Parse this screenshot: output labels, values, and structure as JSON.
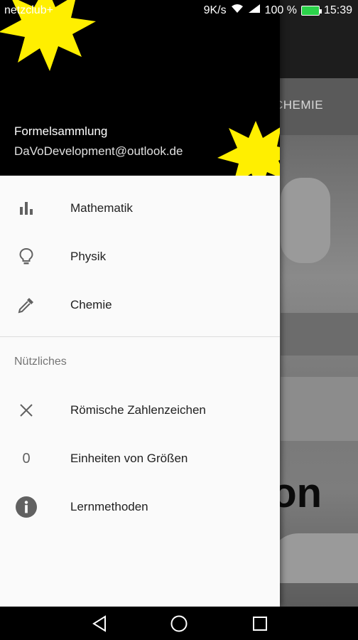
{
  "status_bar": {
    "carrier": "netzclub+",
    "speed": "9K/s",
    "battery_percent": "100 %",
    "time": "15:39"
  },
  "background_app": {
    "visible_tab": "CHEMIE",
    "hero_text": "von"
  },
  "drawer": {
    "header": {
      "app_name": "Formelsammlung",
      "email": "DaVoDevelopment@outlook.de",
      "accent_color": "#FFEF00"
    },
    "items": [
      {
        "label": "Mathematik",
        "icon": "bar-chart-icon"
      },
      {
        "label": "Physik",
        "icon": "lightbulb-icon"
      },
      {
        "label": "Chemie",
        "icon": "pipette-icon"
      }
    ],
    "section_title": "Nützliches",
    "useful_items": [
      {
        "label": "Römische Zahlenzeichen",
        "icon": "close-x-icon"
      },
      {
        "label": "Einheiten von Größen",
        "icon": "zero-icon",
        "icon_text": "0"
      },
      {
        "label": "Lernmethoden",
        "icon": "info-icon"
      }
    ]
  },
  "navigation_bar": {
    "buttons": [
      "back",
      "home",
      "recents"
    ]
  }
}
